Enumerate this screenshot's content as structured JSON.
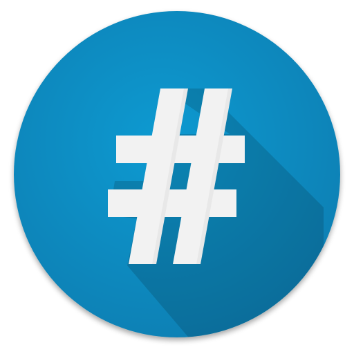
{
  "app_icon": {
    "symbol_name": "hash-symbol",
    "colors": {
      "circle": "#0f9ad1",
      "circle_dark": "#0a7fb3",
      "long_shadow": "#0a6f9d",
      "glyph": "#f2f2f2",
      "glyph_shade": "#d7d7d7",
      "background": "#ffffff"
    }
  }
}
